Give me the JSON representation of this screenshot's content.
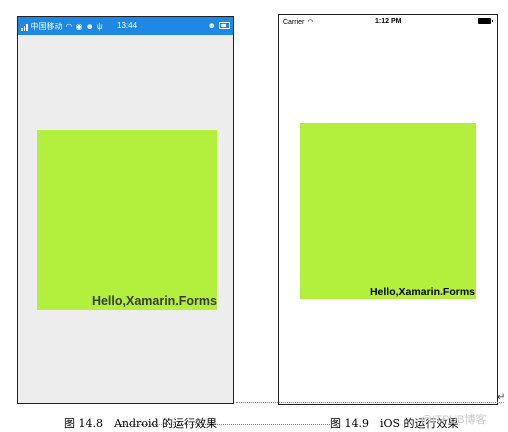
{
  "android": {
    "status_carrier": "中国移动",
    "status_time": "13:44",
    "label": "Hello,Xamarin.Forms",
    "box_color": "#b3ef3d",
    "status_bar_color": "#1e88e5"
  },
  "ios": {
    "carrier": "Carrier",
    "time": "1:12 PM",
    "label": "Hello,Xamarin.Forms",
    "box_color": "#b3ef3d"
  },
  "captions": {
    "left": "图 14.8　Android 的运行效果",
    "right": "图 14.9　iOS 的运行效果"
  },
  "watermark": "@ITPUB博客"
}
